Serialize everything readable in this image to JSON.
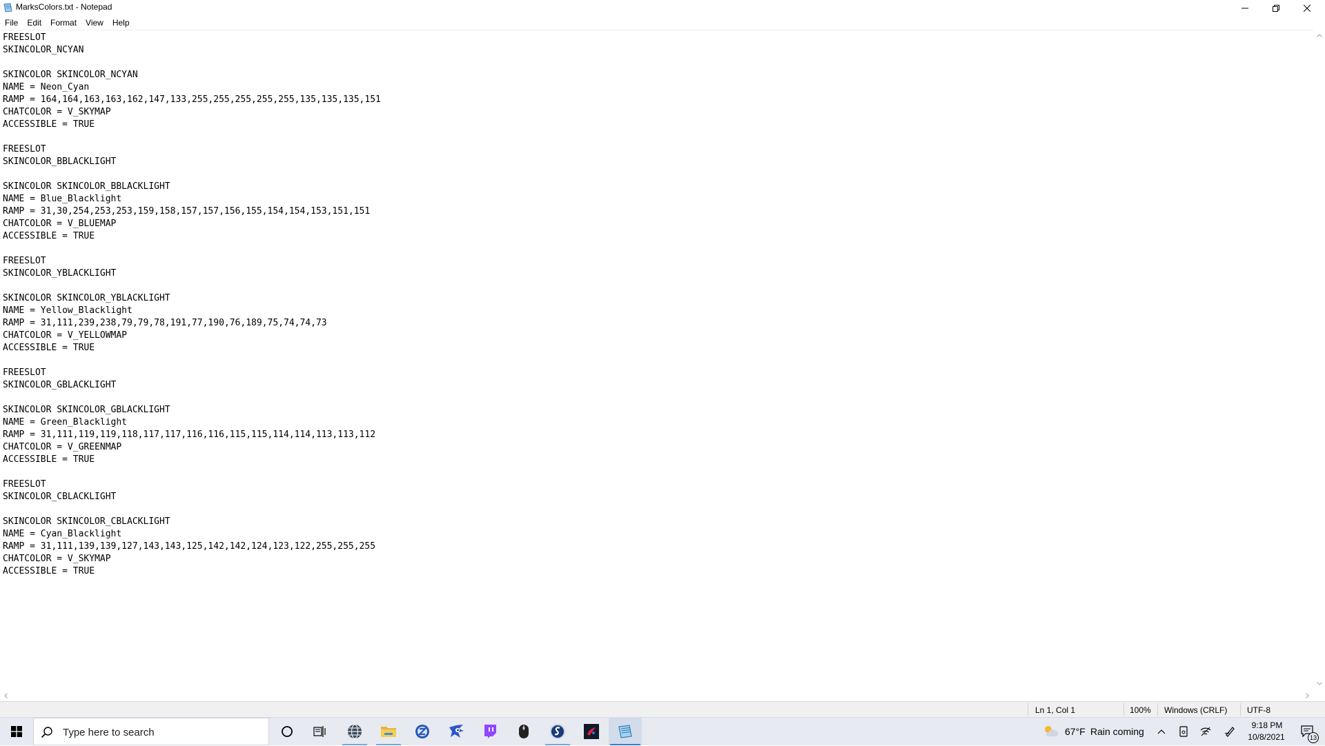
{
  "window": {
    "title": "MarksColors.txt - Notepad"
  },
  "menu": [
    "File",
    "Edit",
    "Format",
    "View",
    "Help"
  ],
  "editor": {
    "lines": [
      "FREESLOT",
      "SKINCOLOR_NCYAN",
      "",
      "SKINCOLOR SKINCOLOR_NCYAN",
      "NAME = Neon_Cyan",
      "RAMP = 164,164,163,163,162,147,133,255,255,255,255,255,135,135,135,151",
      "CHATCOLOR = V_SKYMAP",
      "ACCESSIBLE = TRUE",
      "",
      "FREESLOT",
      "SKINCOLOR_BBLACKLIGHT",
      "",
      "SKINCOLOR SKINCOLOR_BBLACKLIGHT",
      "NAME = Blue_Blacklight",
      "RAMP = 31,30,254,253,253,159,158,157,157,156,155,154,154,153,151,151",
      "CHATCOLOR = V_BLUEMAP",
      "ACCESSIBLE = TRUE",
      "",
      "FREESLOT",
      "SKINCOLOR_YBLACKLIGHT",
      "",
      "SKINCOLOR SKINCOLOR_YBLACKLIGHT",
      "NAME = Yellow_Blacklight",
      "RAMP = 31,111,239,238,79,79,78,191,77,190,76,189,75,74,74,73",
      "CHATCOLOR = V_YELLOWMAP",
      "ACCESSIBLE = TRUE",
      "",
      "FREESLOT",
      "SKINCOLOR_GBLACKLIGHT",
      "",
      "SKINCOLOR SKINCOLOR_GBLACKLIGHT",
      "NAME = Green_Blacklight",
      "RAMP = 31,111,119,119,118,117,117,116,116,115,115,114,114,113,113,112",
      "CHATCOLOR = V_GREENMAP",
      "ACCESSIBLE = TRUE",
      "",
      "FREESLOT",
      "SKINCOLOR_CBLACKLIGHT",
      "",
      "SKINCOLOR SKINCOLOR_CBLACKLIGHT",
      "NAME = Cyan_Blacklight",
      "RAMP = 31,111,139,139,127,143,143,125,142,142,124,123,122,255,255,255",
      "CHATCOLOR = V_SKYMAP",
      "ACCESSIBLE = TRUE"
    ]
  },
  "status": {
    "position": "Ln 1, Col 1",
    "zoom": "100%",
    "line_ending": "Windows (CRLF)",
    "encoding": "UTF-8"
  },
  "taskbar": {
    "search_placeholder": "Type here to search",
    "apps": [
      {
        "icon": "task-view-cortana-icon",
        "state": "none"
      },
      {
        "icon": "task-view-icon",
        "state": "none"
      },
      {
        "icon": "browser-globe-icon",
        "state": "open"
      },
      {
        "icon": "file-explorer-icon",
        "state": "open"
      },
      {
        "icon": "zandronum-icon",
        "state": "none"
      },
      {
        "icon": "sonic-game-icon",
        "state": "none"
      },
      {
        "icon": "twitch-icon",
        "state": "none"
      },
      {
        "icon": "mouse-icon",
        "state": "none"
      },
      {
        "icon": "srb2-icon",
        "state": "open"
      },
      {
        "icon": "dark-app-icon",
        "state": "none"
      },
      {
        "icon": "notepad-icon",
        "state": "active"
      }
    ],
    "weather": {
      "temperature": "67°F",
      "condition": "Rain coming"
    },
    "clock": {
      "time": "9:18 PM",
      "date": "10/8/2021"
    },
    "notification_count": "13"
  },
  "colors": {
    "taskbar_bg": "#e7eaf0",
    "accent": "#2d7fd3",
    "statusbar_bg": "#f0f0f0"
  }
}
